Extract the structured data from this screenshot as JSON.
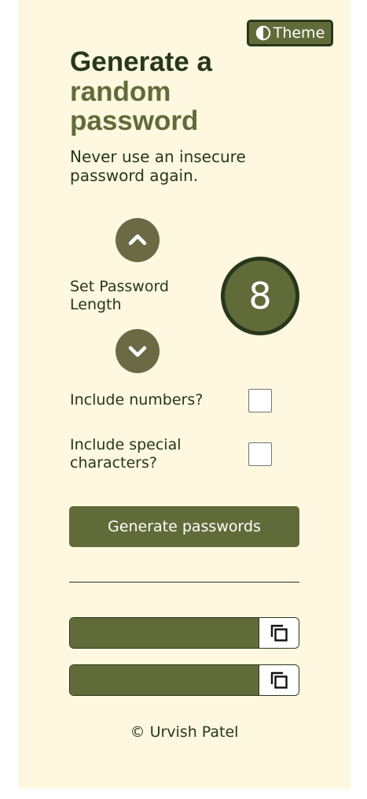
{
  "theme_button": {
    "label": "Theme",
    "icon": "contrast-icon"
  },
  "title": {
    "line1": "Generate a",
    "line2": "random",
    "line3": "password"
  },
  "subtitle": "Never use an insecure password again.",
  "length": {
    "label": "Set Password Length",
    "value": "8",
    "up_icon": "chevron-up-icon",
    "down_icon": "chevron-down-icon"
  },
  "options": {
    "numbers_label": "Include numbers?",
    "numbers_checked": false,
    "special_label": "Include special characters?",
    "special_checked": false
  },
  "generate_button": {
    "label": "Generate passwords"
  },
  "passwords": [
    {
      "value": "",
      "copy_icon": "copy-icon"
    },
    {
      "value": "",
      "copy_icon": "copy-icon"
    }
  ],
  "footer": "© Urvish Patel",
  "colors": {
    "background": "#fdf8df",
    "primary": "#616b3a",
    "dark": "#27371a",
    "stepper": "#6b6a45"
  }
}
